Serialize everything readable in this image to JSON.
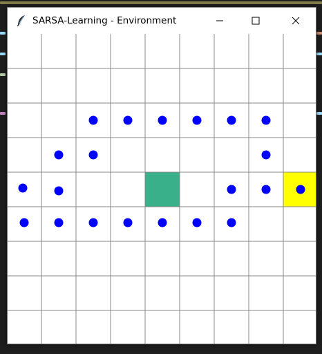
{
  "window": {
    "title": "SARSA-Learning - Environment",
    "icon": "feather-icon"
  },
  "controls": {
    "minimize_icon": "minimize-icon",
    "maximize_icon": "maximize-icon",
    "close_icon": "close-icon"
  },
  "grid": {
    "rows": 9,
    "cols": 9,
    "line_color": "#888888",
    "background": "#ffffff",
    "agent": {
      "row": 4,
      "col": 4,
      "color": "#3ab08a"
    },
    "goal": {
      "row": 4,
      "col": 8,
      "color": "#ffff00"
    },
    "dot_color": "#0000ff",
    "dots": [
      [
        2,
        2
      ],
      [
        2,
        3
      ],
      [
        2,
        4
      ],
      [
        2,
        5
      ],
      [
        2,
        6
      ],
      [
        2,
        7
      ],
      [
        3,
        1
      ],
      [
        3,
        2
      ],
      [
        3,
        7
      ],
      [
        4,
        0
      ],
      [
        4,
        1
      ],
      [
        4,
        6
      ],
      [
        4,
        7
      ],
      [
        4,
        8
      ],
      [
        5,
        0
      ],
      [
        5,
        1
      ],
      [
        5,
        2
      ],
      [
        5,
        3
      ],
      [
        5,
        4
      ],
      [
        5,
        5
      ],
      [
        5,
        6
      ]
    ]
  }
}
